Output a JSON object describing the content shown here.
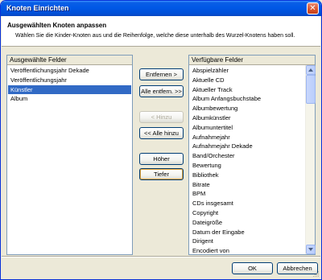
{
  "window": {
    "title": "Knoten Einrichten",
    "close_glyph": "✕"
  },
  "header": {
    "title": "Ausgewählten Knoten anpassen",
    "description": "Wählen Sie die Kinder-Knoten aus und die Reihenfolge, welche diese unterhalb des Wurzel-Knotens haben soll."
  },
  "selected_fields": {
    "heading": "Ausgewählte Felder",
    "items": [
      "Veröffentlichungsjahr Dekade",
      "Veröffentlichungsjahr",
      "Künstler",
      "Album"
    ],
    "selected_index": 2
  },
  "available_fields": {
    "heading": "Verfügbare Felder",
    "items": [
      "Abspielzähler",
      "Aktuelle CD",
      "Aktueller Track",
      "Album Anfangsbuchstabe",
      "Albumbewertung",
      "Albumkünstler",
      "Albumuntertitel",
      "Aufnahmejahr",
      "Aufnahmejahr Dekade",
      "Band/Orchester",
      "Bewertung",
      "Bibliothek",
      "Bitrate",
      "BPM",
      "CDs insgesamt",
      "Copyright",
      "Dateigröße",
      "Datum der Eingabe",
      "Dirigent",
      "Encodiert von"
    ]
  },
  "buttons": {
    "remove": "Entfernen >",
    "remove_all": "Alle entfern. >>",
    "add": "< Hinzu",
    "add_all": "<< Alle hinzu",
    "up": "Höher",
    "down": "Tiefer",
    "ok": "OK",
    "cancel": "Abbrechen"
  },
  "colors": {
    "selection": "#316ac5",
    "title_bar": "#0058e6",
    "dialog_bg": "#ece9d8"
  }
}
